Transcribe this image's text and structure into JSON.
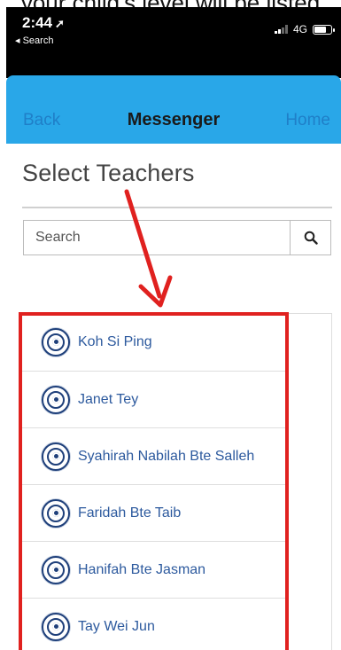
{
  "caption": "your child's level will be listed",
  "status": {
    "time": "2:44",
    "location_arrow": "➚",
    "back_label": "◂ Search",
    "network": "4G"
  },
  "nav": {
    "back_label": "Back",
    "title": "Messenger",
    "home_label": "Home"
  },
  "page": {
    "title": "Select Teachers"
  },
  "search": {
    "placeholder": "Search",
    "value": ""
  },
  "teachers": [
    {
      "name": "Koh Si Ping"
    },
    {
      "name": "Janet Tey"
    },
    {
      "name": "Syahirah Nabilah Bte Salleh"
    },
    {
      "name": "Faridah Bte Taib"
    },
    {
      "name": "Hanifah Bte Jasman"
    },
    {
      "name": "Tay Wei Jun"
    }
  ],
  "colors": {
    "nav_bar": "#29a7e8",
    "nav_link": "#1f7fc8",
    "teacher_name": "#2d5a9e",
    "annotation_red": "#e0211f"
  }
}
